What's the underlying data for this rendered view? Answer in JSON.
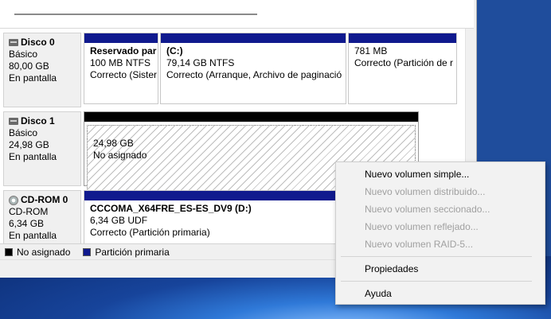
{
  "legend": {
    "unallocated": "No asignado",
    "primary": "Partición primaria",
    "colors": {
      "unallocated": "#000000",
      "primary": "#101a8e"
    }
  },
  "disks": [
    {
      "name": "Disco 0",
      "type": "Básico",
      "size": "80,00 GB",
      "status": "En pantalla",
      "partitions": [
        {
          "title": "Reservado par",
          "size": "100 MB NTFS",
          "status": "Correcto (Sister"
        },
        {
          "title": "(C:)",
          "size": "79,14 GB NTFS",
          "status": "Correcto (Arranque, Archivo de paginació"
        },
        {
          "title": "",
          "size": "781 MB",
          "status": "Correcto (Partición de r"
        }
      ]
    },
    {
      "name": "Disco 1",
      "type": "Básico",
      "size": "24,98 GB",
      "status": "En pantalla",
      "partitions": [
        {
          "size": "24,98 GB",
          "status": "No asignado"
        }
      ]
    },
    {
      "name": "CD-ROM 0",
      "type": "CD-ROM",
      "size": "6,34 GB",
      "status": "En pantalla",
      "partitions": [
        {
          "title": "CCCOMA_X64FRE_ES-ES_DV9  (D:)",
          "size": "6,34 GB UDF",
          "status": "Correcto (Partición primaria)"
        }
      ]
    }
  ],
  "context_menu": {
    "items": [
      {
        "label": "Nuevo volumen simple...",
        "enabled": true
      },
      {
        "label": "Nuevo volumen distribuido...",
        "enabled": false
      },
      {
        "label": "Nuevo volumen seccionado...",
        "enabled": false
      },
      {
        "label": "Nuevo volumen reflejado...",
        "enabled": false
      },
      {
        "label": "Nuevo volumen RAID-5...",
        "enabled": false
      },
      {
        "label": "Propiedades",
        "enabled": true
      },
      {
        "label": "Ayuda",
        "enabled": true
      }
    ]
  }
}
